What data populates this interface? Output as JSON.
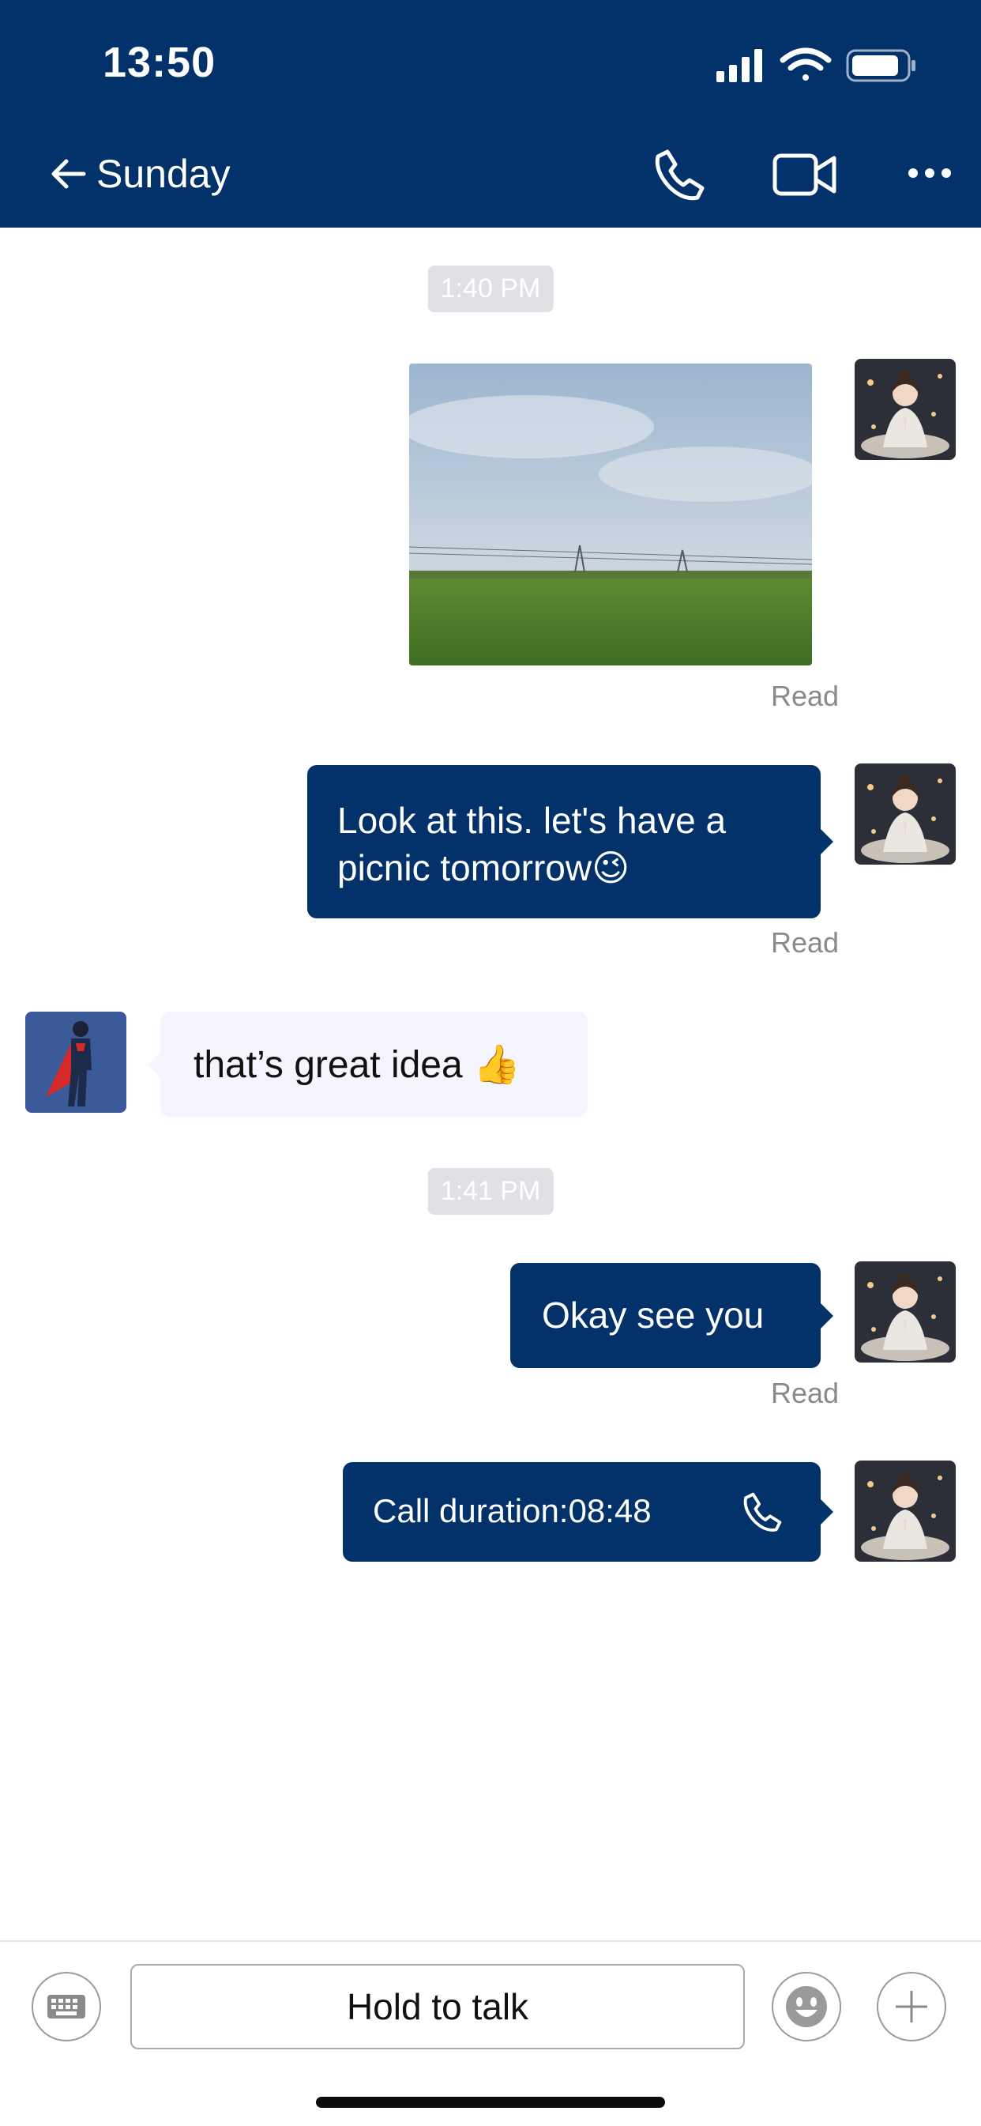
{
  "status_bar": {
    "time": "13:50"
  },
  "header": {
    "back_icon": "arrow-left-icon",
    "title": "Sunday",
    "actions": [
      "phone-icon",
      "video-icon",
      "more-icon"
    ]
  },
  "messages": {
    "time1": "1:40 PM",
    "time2": "1:41 PM",
    "msg_text1": "Look at this. let's have a picnic tomorrow😉",
    "msg_in1": "that’s great idea 👍",
    "msg_text2": "Okay see you",
    "call_text": "Call duration:08:48",
    "read_label": "Read"
  },
  "input_bar": {
    "keyboard_icon": "keyboard-icon",
    "hold_to_talk": "Hold to talk",
    "emoji_icon": "smiley-icon",
    "plus_icon": "plus-icon"
  },
  "colors": {
    "header_bg": "#023269",
    "outgoing_bubble": "#023269",
    "incoming_bubble": "#f4f5fd"
  }
}
